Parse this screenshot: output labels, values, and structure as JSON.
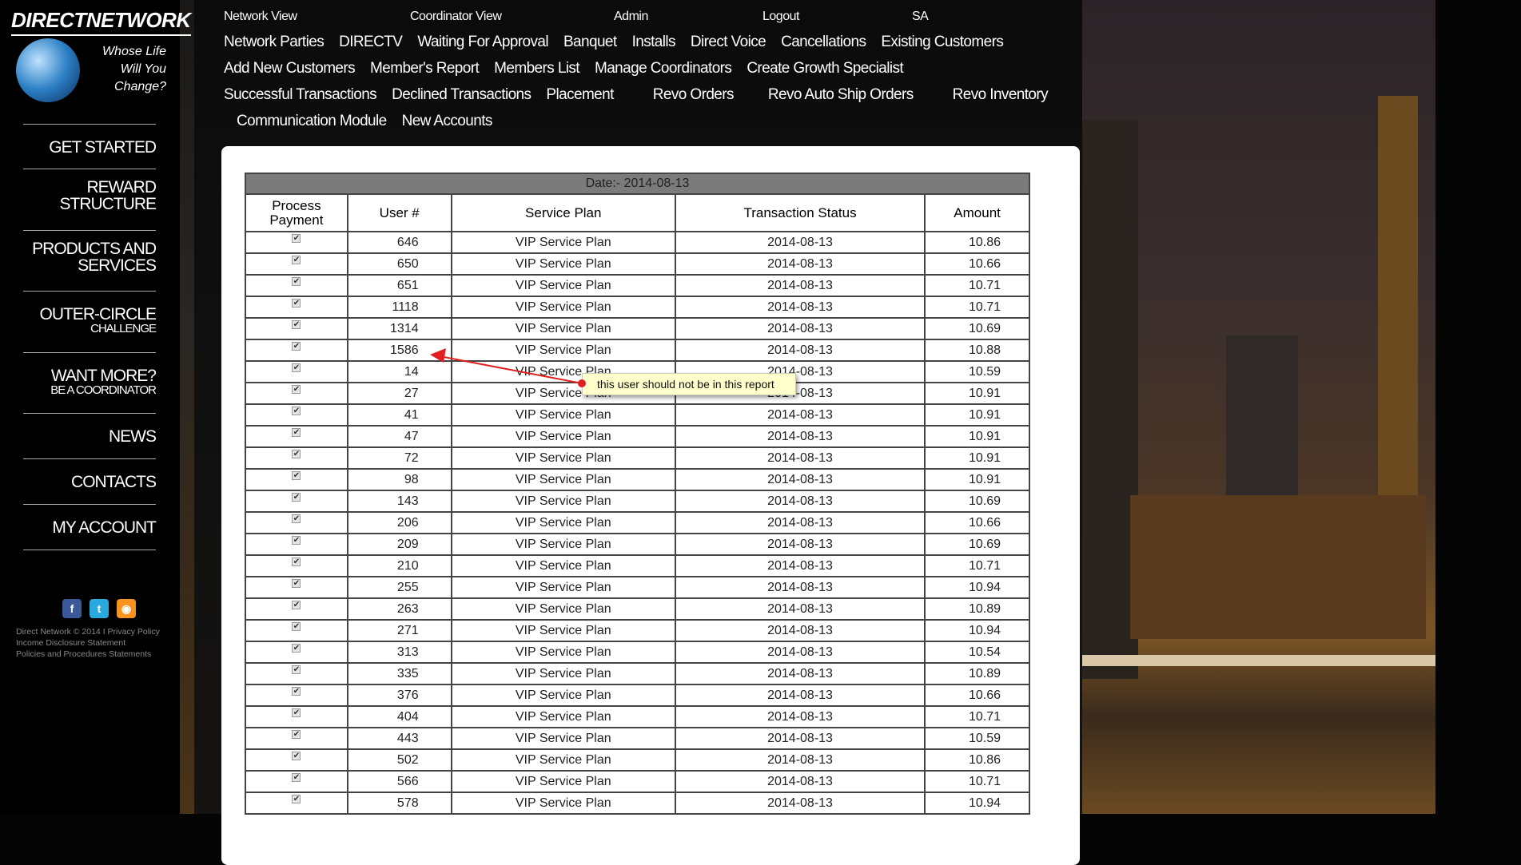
{
  "brand": {
    "name": "DIRECTNETWORK",
    "tagline": [
      "Whose Life",
      "Will You",
      "Change?"
    ]
  },
  "sidebar": {
    "items": [
      {
        "label": "GET STARTED",
        "sub": ""
      },
      {
        "label": "REWARD STRUCTURE",
        "sub": ""
      },
      {
        "label": "PRODUCTS AND SERVICES",
        "sub": ""
      },
      {
        "label": "OUTER-CIRCLE",
        "sub": "CHALLENGE"
      },
      {
        "label": "WANT MORE?",
        "sub": "BE A COORDINATOR"
      },
      {
        "label": "NEWS",
        "sub": ""
      },
      {
        "label": "CONTACTS",
        "sub": ""
      },
      {
        "label": "MY ACCOUNT",
        "sub": ""
      }
    ],
    "social": [
      {
        "icon": "facebook-icon",
        "glyph": "f",
        "color": "#3b5998"
      },
      {
        "icon": "twitter-icon",
        "glyph": "t",
        "color": "#2aa9e0"
      },
      {
        "icon": "rss-icon",
        "glyph": "◉",
        "color": "#f7931e"
      }
    ],
    "footer": [
      "Direct Network © 2014 I Privacy Policy",
      "Income Disclosure Statement",
      "Policies and Procedures Statements"
    ]
  },
  "topnav": {
    "row1": [
      "Network View",
      "Coordinator View",
      "Admin",
      "Logout",
      "SA"
    ],
    "rows": [
      [
        "Network Parties",
        "DIRECTV",
        "Waiting For Approval",
        "Banquet",
        "Installs",
        "Direct Voice",
        "Cancellations",
        "Existing Customers"
      ],
      [
        "Add New Customers",
        "Member's Report",
        "Members List",
        "Manage Coordinators",
        "Create Growth Specialist"
      ],
      [
        "Successful Transactions",
        "Declined Transactions",
        "Placement",
        "Revo Orders",
        "Revo Auto Ship Orders",
        "Revo Inventory"
      ],
      [
        "Communication Module",
        "New Accounts"
      ]
    ]
  },
  "table": {
    "date_label": "Date:- 2014-08-13",
    "headers": [
      "Process Payment",
      "User #",
      "Service Plan",
      "Transaction Status",
      "Amount"
    ],
    "rows": [
      [
        "646",
        "VIP Service Plan",
        "2014-08-13",
        "10.86"
      ],
      [
        "650",
        "VIP Service Plan",
        "2014-08-13",
        "10.66"
      ],
      [
        "651",
        "VIP Service Plan",
        "2014-08-13",
        "10.71"
      ],
      [
        "1118",
        "VIP Service Plan",
        "2014-08-13",
        "10.71"
      ],
      [
        "1314",
        "VIP Service Plan",
        "2014-08-13",
        "10.69"
      ],
      [
        "1586",
        "VIP Service Plan",
        "2014-08-13",
        "10.88"
      ],
      [
        "14",
        "VIP Service Plan",
        "2014-08-13",
        "10.59"
      ],
      [
        "27",
        "VIP Service Plan",
        "2014-08-13",
        "10.91"
      ],
      [
        "41",
        "VIP Service Plan",
        "2014-08-13",
        "10.91"
      ],
      [
        "47",
        "VIP Service Plan",
        "2014-08-13",
        "10.91"
      ],
      [
        "72",
        "VIP Service Plan",
        "2014-08-13",
        "10.91"
      ],
      [
        "98",
        "VIP Service Plan",
        "2014-08-13",
        "10.91"
      ],
      [
        "143",
        "VIP Service Plan",
        "2014-08-13",
        "10.69"
      ],
      [
        "206",
        "VIP Service Plan",
        "2014-08-13",
        "10.66"
      ],
      [
        "209",
        "VIP Service Plan",
        "2014-08-13",
        "10.69"
      ],
      [
        "210",
        "VIP Service Plan",
        "2014-08-13",
        "10.71"
      ],
      [
        "255",
        "VIP Service Plan",
        "2014-08-13",
        "10.94"
      ],
      [
        "263",
        "VIP Service Plan",
        "2014-08-13",
        "10.89"
      ],
      [
        "271",
        "VIP Service Plan",
        "2014-08-13",
        "10.94"
      ],
      [
        "313",
        "VIP Service Plan",
        "2014-08-13",
        "10.54"
      ],
      [
        "335",
        "VIP Service Plan",
        "2014-08-13",
        "10.89"
      ],
      [
        "376",
        "VIP Service Plan",
        "2014-08-13",
        "10.66"
      ],
      [
        "404",
        "VIP Service Plan",
        "2014-08-13",
        "10.71"
      ],
      [
        "443",
        "VIP Service Plan",
        "2014-08-13",
        "10.59"
      ],
      [
        "502",
        "VIP Service Plan",
        "2014-08-13",
        "10.86"
      ],
      [
        "566",
        "VIP Service Plan",
        "2014-08-13",
        "10.71"
      ],
      [
        "578",
        "VIP Service Plan",
        "2014-08-13",
        "10.94"
      ]
    ]
  },
  "annotation": {
    "text": "this user should not be in this report",
    "color": "#e02020"
  }
}
